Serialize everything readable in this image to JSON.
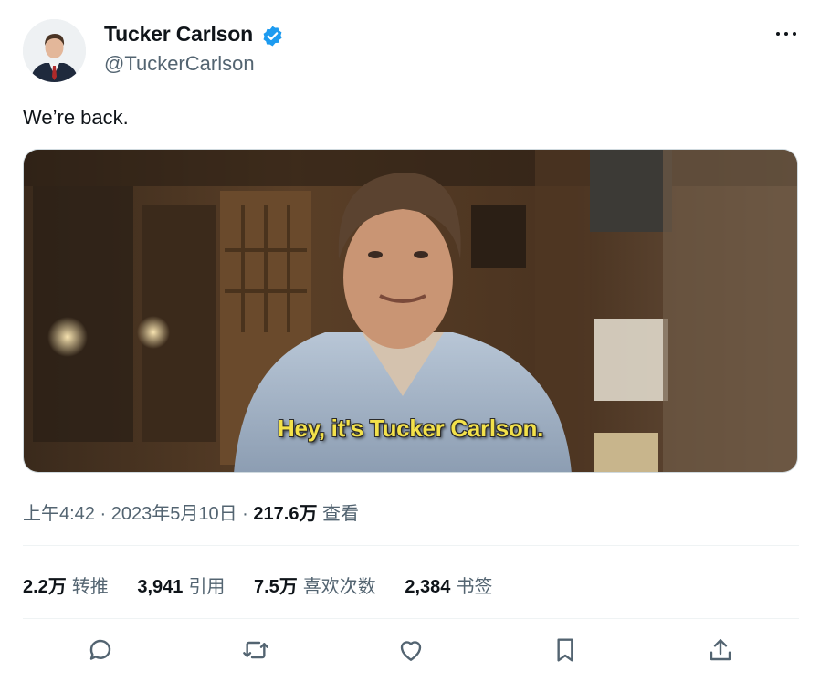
{
  "author": {
    "name": "Tucker Carlson",
    "handle": "@TuckerCarlson",
    "verified": true
  },
  "tweet": {
    "text": "We’re back.",
    "video_caption": "Hey, it's Tucker Carlson."
  },
  "meta": {
    "time": "上午4:42",
    "separator": "·",
    "date": "2023年5月10日",
    "views_count": "217.6万",
    "views_label": "查看"
  },
  "stats": [
    {
      "value": "2.2万",
      "label": "转推"
    },
    {
      "value": "3,941",
      "label": "引用"
    },
    {
      "value": "7.5万",
      "label": "喜欢次数"
    },
    {
      "value": "2,384",
      "label": "书签"
    }
  ],
  "actions": [
    "reply-icon",
    "retweet-icon",
    "like-icon",
    "bookmark-icon",
    "share-icon"
  ],
  "colors": {
    "verified_blue": "#1d9bf0",
    "secondary_text": "#536471",
    "caption_yellow": "#f3e14a"
  }
}
